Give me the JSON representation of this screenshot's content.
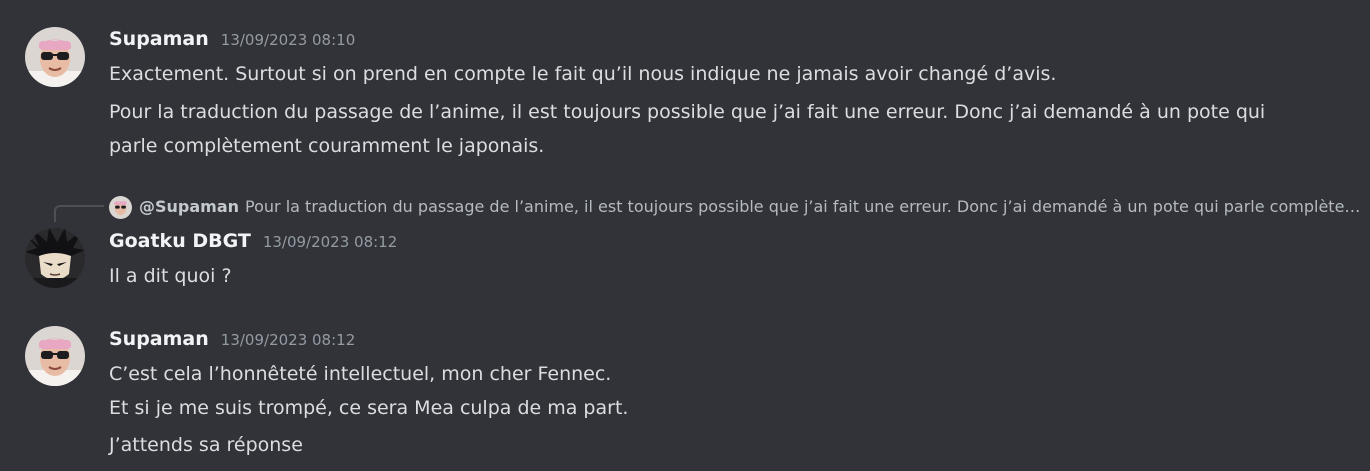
{
  "messages": [
    {
      "author": "Supaman",
      "timestamp": "13/09/2023 08:10",
      "avatar": "supaman-avatar",
      "lines": [
        "Exactement. Surtout si on prend en compte le fait qu’il nous indique ne jamais avoir changé d’avis.",
        "Pour la traduction du passage de l’anime, il est toujours possible que j’ai fait une erreur. Donc j’ai demandé à un pote qui",
        "parle complètement couramment le japonais."
      ]
    },
    {
      "author": "Goatku DBGT",
      "timestamp": "13/09/2023 08:12",
      "avatar": "goatku-avatar",
      "reply": {
        "mention": "@Supaman",
        "preview": "Pour la traduction du passage de l’anime, il est toujours possible que j’ai fait une erreur. Donc j’ai demandé à un pote qui parle complètement couramment le japonais."
      },
      "lines": [
        "Il a dit quoi ?"
      ]
    },
    {
      "author": "Supaman",
      "timestamp": "13/09/2023 08:12",
      "avatar": "supaman-avatar",
      "lines": [
        "C’est cela l’honnêteté intellectuel, mon cher Fennec.",
        "Et si je me suis trompé, ce sera Mea culpa de ma part.",
        "J’attends sa réponse"
      ]
    }
  ],
  "colors": {
    "background": "#313338",
    "author": "#f2f3f5",
    "timestamp": "#949ba4",
    "text": "#dbdee1",
    "reply_text": "#b5bac1"
  }
}
